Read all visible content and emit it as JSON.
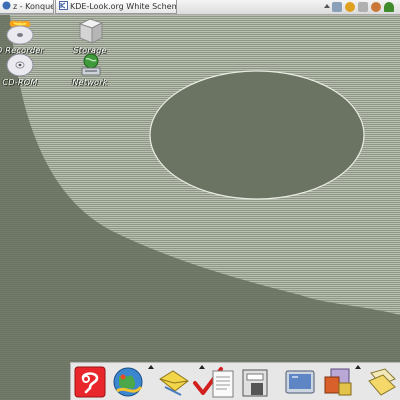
{
  "taskbar": {
    "tasks": [
      {
        "label": "z - Konquer",
        "icon": "konqueror-icon"
      },
      {
        "label": "KDE-Look.org White Schem",
        "icon": "kde-icon"
      }
    ],
    "tray_icons": [
      "network-tray-icon",
      "hand-tray-icon",
      "lock-tray-icon",
      "user-tray-icon",
      "tree-tray-icon"
    ]
  },
  "desktop": {
    "icons": [
      {
        "label": "D Recorder",
        "icon": "cd-burner-icon"
      },
      {
        "label": "Storage",
        "icon": "storage-icon"
      },
      {
        "label": "CD-ROM",
        "icon": "cdrom-icon"
      },
      {
        "label": "Network",
        "icon": "network-icon"
      }
    ]
  },
  "panel": {
    "buttons": [
      "help-icon",
      "browser-icon",
      "mail-icon",
      "checkmark-icon",
      "file-manager-icon",
      "terminal-icon",
      "applications-icon",
      "folder-icon"
    ]
  },
  "colors": {
    "desktop": "#6f7766",
    "desktop_light": "#aab2a3",
    "panel": "#e7e7e7"
  }
}
